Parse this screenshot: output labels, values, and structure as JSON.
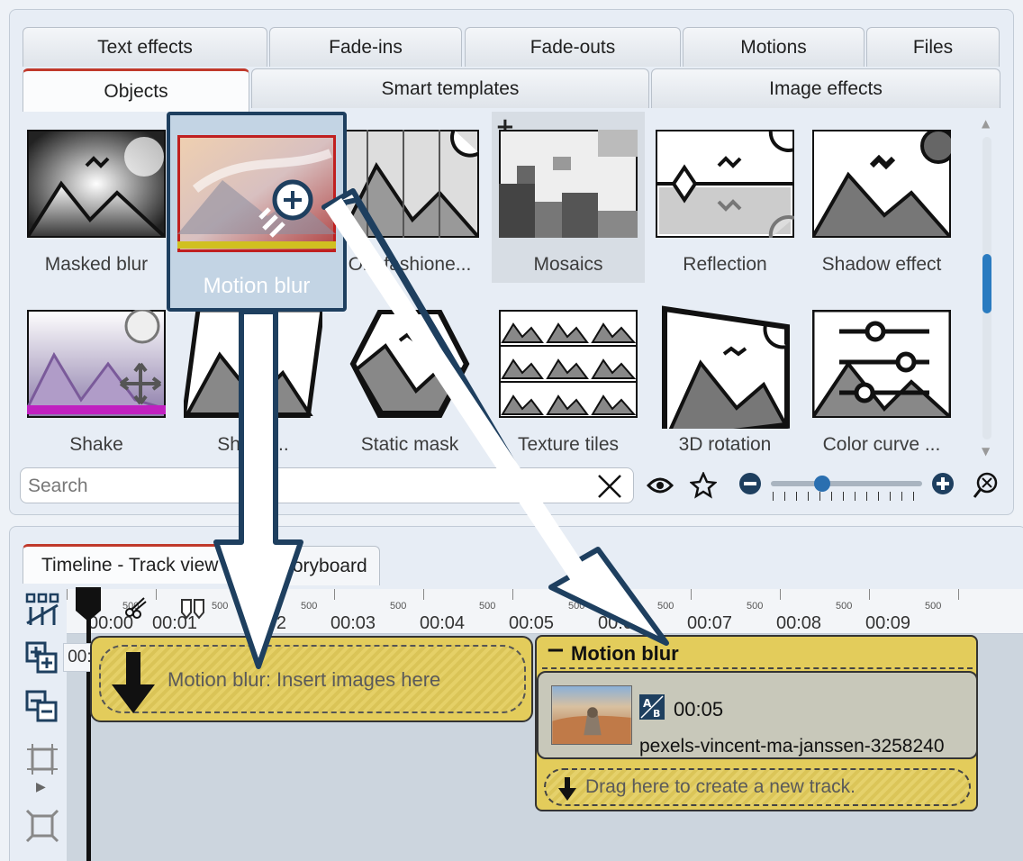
{
  "tabs_row1": [
    "Text effects",
    "Fade-ins",
    "Fade-outs",
    "Motions",
    "Files"
  ],
  "tabs_row2": [
    "Objects",
    "Smart templates",
    "Image effects"
  ],
  "gallery": {
    "row1": [
      "Masked blur",
      "Motion blur",
      "Old-fashione...",
      "Mosaics",
      "Reflection",
      "Shadow effect"
    ],
    "row2": [
      "Shake",
      "Shear ...",
      "Static mask",
      "Texture tiles",
      "3D rotation",
      "Color curve ..."
    ],
    "add_symbol": "+"
  },
  "search": {
    "placeholder": "Search",
    "value": ""
  },
  "timeline_tabs": [
    "Timeline - Track view",
    "Storyboard"
  ],
  "ruler": {
    "labels": [
      "00:00",
      "00:01",
      "00:02",
      "00:03",
      "00:04",
      "00:05",
      "00:06",
      "00:07",
      "00:08",
      "00:09"
    ],
    "subticks": [
      "500",
      "500",
      "500",
      "500",
      "500",
      "500",
      "500",
      "500",
      "500",
      "500"
    ]
  },
  "time_badge": "00:00",
  "insert": {
    "text": "Motion blur: Insert images here"
  },
  "motion_blur_group": {
    "title": "Motion blur",
    "collapse_symbol": "−",
    "clip_duration": "00:05",
    "clip_name": "pexels-vincent-ma-janssen-3258240",
    "drag_text": "Drag here to create a new track."
  }
}
